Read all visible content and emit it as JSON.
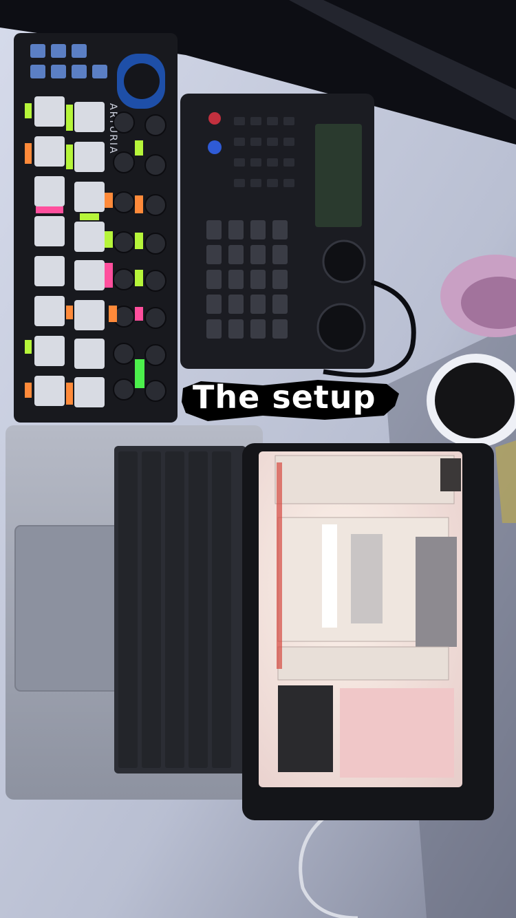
{
  "caption": {
    "text": "The setup"
  },
  "brand": {
    "controller": "ARTURIA"
  },
  "colors": {
    "background": "#0d0e14",
    "desk": "#c9cfe0",
    "controller": "#18191e",
    "drum_machine": "#1b1c22",
    "laptop": "#a3a8b6",
    "tablet_screen": "#f4e7e1",
    "label_lime": "#b6f53a",
    "label_orange": "#ff8a3a",
    "label_pink": "#ff4f9d",
    "caption_text": "#ffffff",
    "caption_brush": "#000000"
  }
}
